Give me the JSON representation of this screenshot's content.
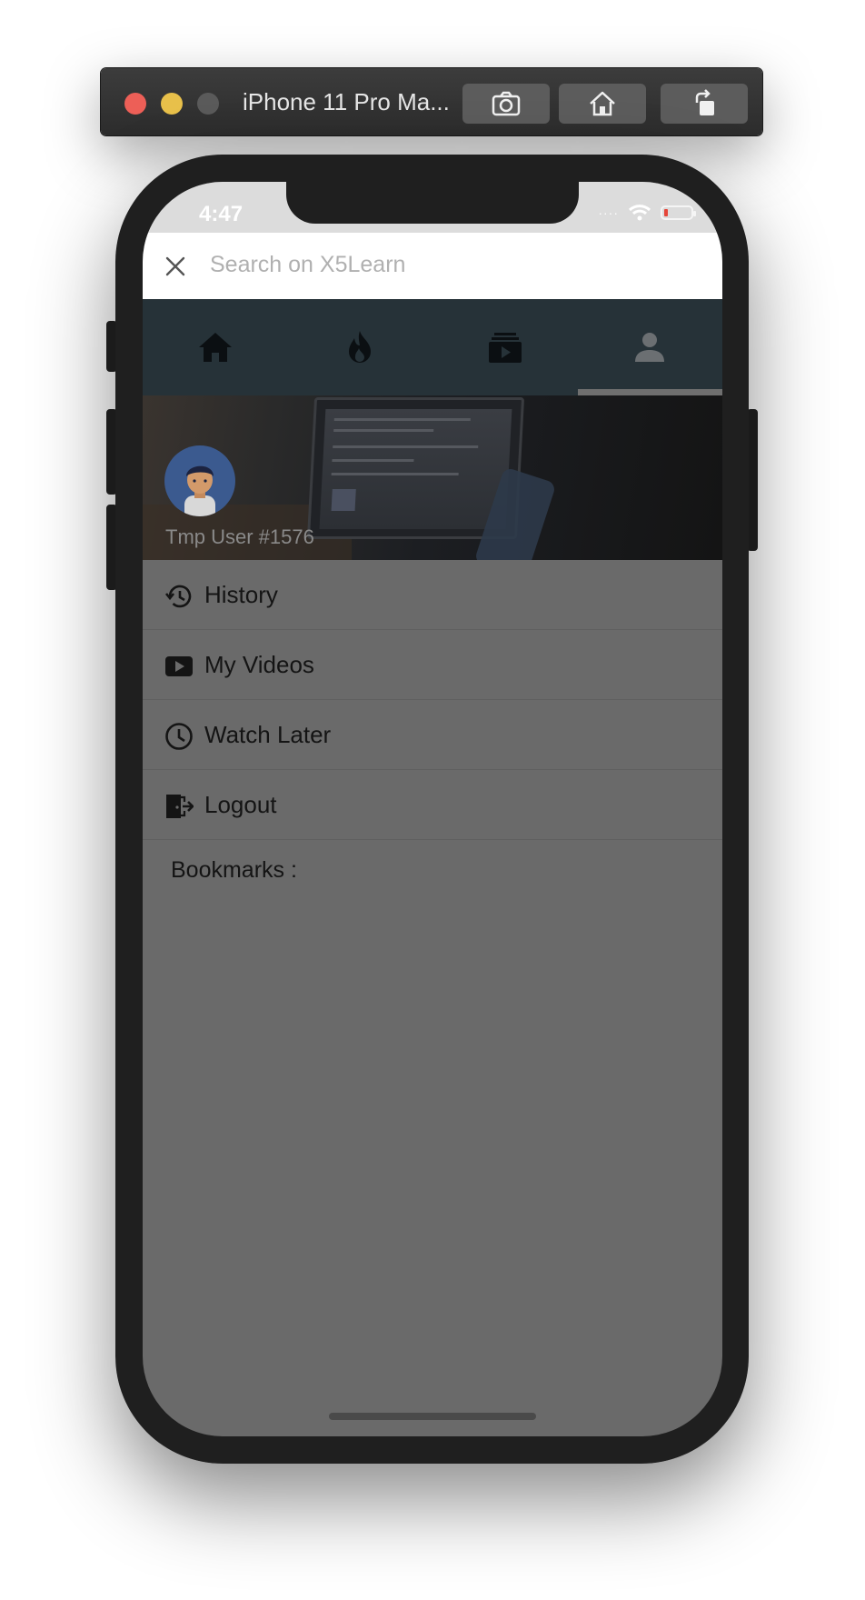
{
  "window": {
    "title": "iPhone 11 Pro Ma...",
    "buttons": [
      "screenshot-button",
      "home-button",
      "rotate-button"
    ]
  },
  "status_bar": {
    "time": "4:47"
  },
  "search": {
    "placeholder": "Search on X5Learn"
  },
  "tabs": [
    {
      "icon": "home-icon",
      "active": false
    },
    {
      "icon": "fire-icon",
      "active": false
    },
    {
      "icon": "playlist-icon",
      "active": false
    },
    {
      "icon": "person-icon",
      "active": true
    }
  ],
  "profile": {
    "user_name": "Tmp User #1576"
  },
  "menu": {
    "items": [
      {
        "label": "History",
        "icon": "history-icon"
      },
      {
        "label": "My Videos",
        "icon": "video-icon"
      },
      {
        "label": "Watch Later",
        "icon": "clock-icon"
      },
      {
        "label": "Logout",
        "icon": "logout-icon"
      }
    ],
    "bookmarks_label": "Bookmarks :"
  },
  "colors": {
    "tab_bar": "#263238",
    "overlay": "#6a6a6a",
    "avatar_bg": "#3b5a8f"
  }
}
